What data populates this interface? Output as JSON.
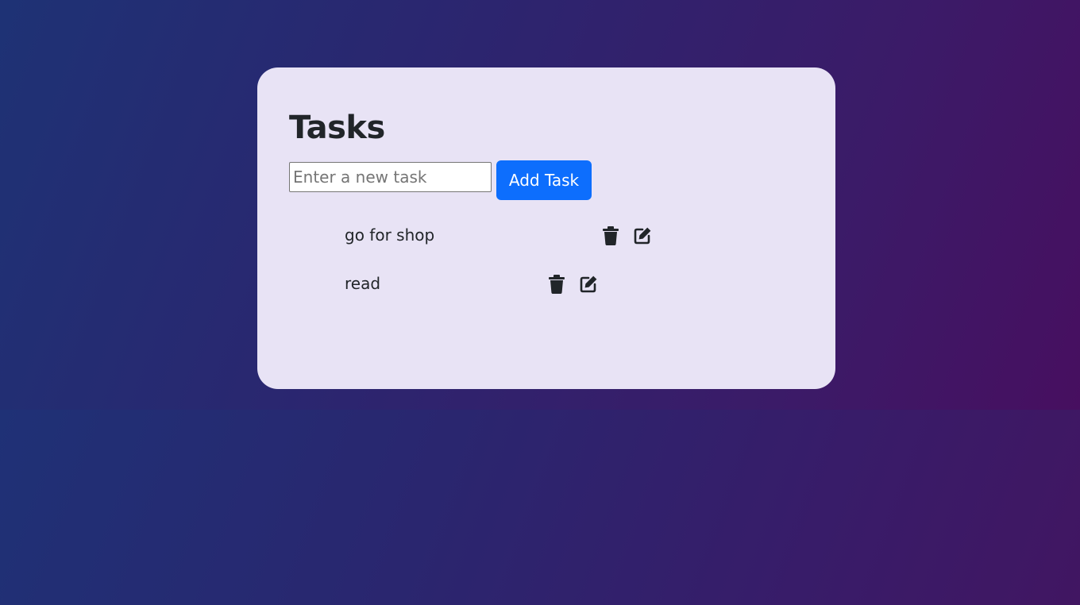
{
  "app": {
    "title": "Tasks"
  },
  "form": {
    "placeholder": "Enter a new task",
    "value": "",
    "add_label": "Add Task"
  },
  "tasks": [
    {
      "text": "go for shop",
      "actions": [
        "trash-icon",
        "edit-icon"
      ]
    },
    {
      "text": "read",
      "actions": [
        "trash-icon",
        "edit-icon"
      ]
    }
  ],
  "colors": {
    "card_bg": "#e8e3f5",
    "accent": "#0d6efd",
    "text": "#212529",
    "icon": "#212529",
    "bg_gradient_start": "#1e3275",
    "bg_gradient_end": "#470f60"
  }
}
